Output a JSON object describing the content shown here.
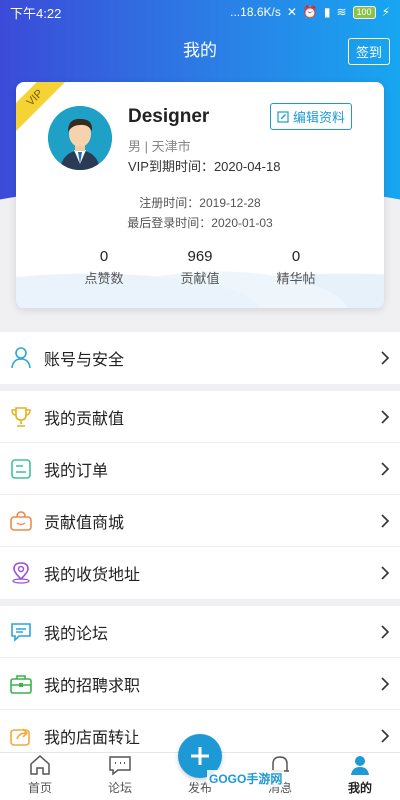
{
  "status_bar": {
    "time": "下午4:22",
    "network": "...18.6K/s",
    "battery": "100"
  },
  "header": {
    "title": "我的",
    "signin_label": "签到"
  },
  "profile": {
    "vip_tag": "VIP",
    "username": "Designer",
    "edit_label": "编辑资料",
    "gender_city": "男 | 天津市",
    "vip_expire": "VIP到期时间：2020-04-18",
    "register_time": "注册时间：2019-12-28",
    "last_login": "最后登录时间：2020-01-03",
    "stats": [
      {
        "value": "0",
        "label": "点赞数"
      },
      {
        "value": "969",
        "label": "贡献值"
      },
      {
        "value": "0",
        "label": "精华帖"
      }
    ]
  },
  "menu": {
    "account": {
      "label": "账号与安全",
      "icon": "user-icon"
    },
    "group2": [
      {
        "label": "我的贡献值",
        "icon": "trophy-icon"
      },
      {
        "label": "我的订单",
        "icon": "order-icon"
      },
      {
        "label": "贡献值商城",
        "icon": "bag-icon"
      },
      {
        "label": "我的收货地址",
        "icon": "location-icon"
      }
    ],
    "group3": [
      {
        "label": "我的论坛",
        "icon": "forum-icon"
      },
      {
        "label": "我的招聘求职",
        "icon": "briefcase-icon"
      },
      {
        "label": "我的店面转让",
        "icon": "share-icon"
      }
    ]
  },
  "bottom_nav": [
    {
      "label": "首页",
      "icon": "home-icon"
    },
    {
      "label": "论坛",
      "icon": "chat-icon"
    },
    {
      "label": "发布",
      "icon": "plus-icon"
    },
    {
      "label": "消息",
      "icon": "bell-icon"
    },
    {
      "label": "我的",
      "icon": "profile-icon"
    }
  ],
  "watermark": "GOGO手游网",
  "colors": {
    "accent": "#1d9ad6",
    "header_start": "#3b4bd8",
    "header_end": "#17a6f0",
    "vip": "#f5d335"
  }
}
